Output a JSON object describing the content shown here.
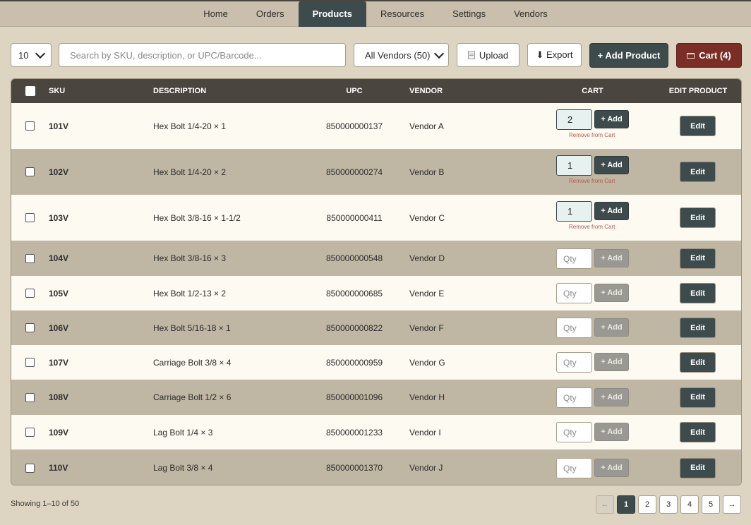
{
  "nav": {
    "tabs": [
      {
        "label": "Home",
        "active": false
      },
      {
        "label": "Orders",
        "active": false
      },
      {
        "label": "Products",
        "active": true
      },
      {
        "label": "Resources",
        "active": false
      },
      {
        "label": "Settings",
        "active": false
      },
      {
        "label": "Vendors",
        "active": false
      }
    ]
  },
  "toolbar": {
    "page_size": "10",
    "search_placeholder": "Search by SKU, description, or UPC/Barcode...",
    "vendor_filter": "All Vendors (50)",
    "upload_label": "Upload",
    "export_label": "⬇ Export",
    "add_product_label": "+ Add Product",
    "cart_label": "Cart (4)"
  },
  "table": {
    "headers": {
      "sku": "SKU",
      "description": "DESCRIPTION",
      "upc": "UPC",
      "vendor": "VENDOR",
      "cart": "CART",
      "edit": "EDIT PRODUCT"
    },
    "qty_placeholder": "Qty",
    "add_label": "+ Add",
    "remove_label": "Remove from Cart",
    "edit_label": "Edit",
    "rows": [
      {
        "sku": "101V",
        "description": "Hex Bolt 1/4-20 × 1",
        "upc": "850000000137",
        "vendor": "Vendor A",
        "qty": "2"
      },
      {
        "sku": "102V",
        "description": "Hex Bolt 1/4-20 × 2",
        "upc": "850000000274",
        "vendor": "Vendor B",
        "qty": "1"
      },
      {
        "sku": "103V",
        "description": "Hex Bolt 3/8-16 × 1-1/2",
        "upc": "850000000411",
        "vendor": "Vendor C",
        "qty": "1"
      },
      {
        "sku": "104V",
        "description": "Hex Bolt 3/8-16 × 3",
        "upc": "850000000548",
        "vendor": "Vendor D",
        "qty": ""
      },
      {
        "sku": "105V",
        "description": "Hex Bolt 1/2-13 × 2",
        "upc": "850000000685",
        "vendor": "Vendor E",
        "qty": ""
      },
      {
        "sku": "106V",
        "description": "Hex Bolt 5/16-18 × 1",
        "upc": "850000000822",
        "vendor": "Vendor F",
        "qty": ""
      },
      {
        "sku": "107V",
        "description": "Carriage Bolt 3/8 × 4",
        "upc": "850000000959",
        "vendor": "Vendor G",
        "qty": ""
      },
      {
        "sku": "108V",
        "description": "Carriage Bolt 1/2 × 6",
        "upc": "850000001096",
        "vendor": "Vendor H",
        "qty": ""
      },
      {
        "sku": "109V",
        "description": "Lag Bolt 1/4 × 3",
        "upc": "850000001233",
        "vendor": "Vendor I",
        "qty": ""
      },
      {
        "sku": "110V",
        "description": "Lag Bolt 3/8 × 4",
        "upc": "850000001370",
        "vendor": "Vendor J",
        "qty": ""
      }
    ]
  },
  "footer": {
    "showing": "Showing 1–10 of 50",
    "prev": "←",
    "next": "→",
    "pages": [
      "1",
      "2",
      "3",
      "4",
      "5"
    ],
    "current_page": "1"
  },
  "colors": {
    "accent": "#3d4b4d",
    "cart": "#7a2e26",
    "header": "#4b4540",
    "background": "#ddd4c1"
  }
}
